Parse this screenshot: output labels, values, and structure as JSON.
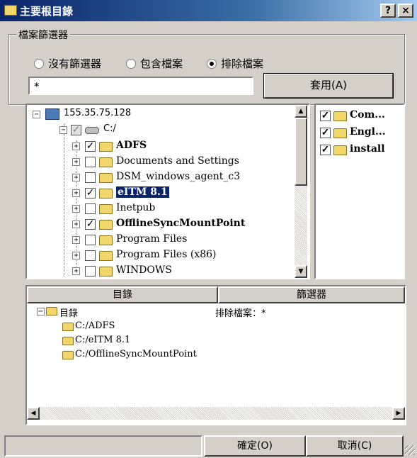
{
  "window": {
    "title": "主要根目錄",
    "help_button": "?",
    "close_button": "×"
  },
  "filter": {
    "group_label": "檔案篩選器",
    "options": [
      {
        "label": "沒有篩選器",
        "selected": false
      },
      {
        "label": "包含檔案",
        "selected": false
      },
      {
        "label": "排除檔案",
        "selected": true
      }
    ],
    "input_value": "*",
    "apply_button": "套用(A)"
  },
  "tree": {
    "host": "155.35.75.128",
    "drive": "C:/",
    "items": [
      {
        "label": "ADFS",
        "checked": true,
        "bold": true,
        "highlight": false
      },
      {
        "label": "Documents and Settings",
        "checked": false,
        "bold": false,
        "highlight": false
      },
      {
        "label": "DSM_windows_agent_c3",
        "checked": false,
        "bold": false,
        "highlight": false
      },
      {
        "label": "eITM 8.1",
        "checked": true,
        "bold": true,
        "highlight": true
      },
      {
        "label": "Inetpub",
        "checked": false,
        "bold": false,
        "highlight": false
      },
      {
        "label": "OfflineSyncMountPoint",
        "checked": true,
        "bold": true,
        "highlight": false
      },
      {
        "label": "Program Files",
        "checked": false,
        "bold": false,
        "highlight": false
      },
      {
        "label": "Program Files (x86)",
        "checked": false,
        "bold": false,
        "highlight": false
      },
      {
        "label": "WINDOWS",
        "checked": false,
        "bold": false,
        "highlight": false
      }
    ]
  },
  "right_list": [
    {
      "label": "Com...",
      "checked": true
    },
    {
      "label": "Engl...",
      "checked": true
    },
    {
      "label": "install",
      "checked": true
    }
  ],
  "bottom": {
    "col_directory": "目錄",
    "col_filter": "篩選器",
    "root_label": "目錄",
    "filter_value": "排除檔案：*",
    "paths": [
      "C:/ADFS",
      "C:/eITM 8.1",
      "C:/OfflineSyncMountPoint"
    ]
  },
  "buttons": {
    "ok": "確定(O)",
    "cancel": "取消(C)"
  }
}
